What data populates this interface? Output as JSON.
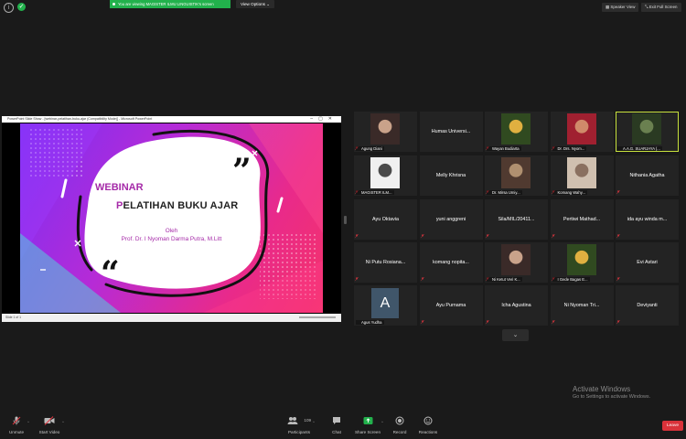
{
  "topbar": {
    "share_banner": "You are viewing MAGISTER ILMU LINGUISTIK's screen",
    "view_options": "View Options",
    "speaker_view": "Speaker View",
    "exit_full_screen": "Exit Full Screen",
    "colors": {
      "banner": "#22b14c"
    }
  },
  "shared_window": {
    "titlebar": "PowerPoint Slide Show - [webinar-pelatihan-buku-ajar (Compatibility Mode)] - Microsoft PowerPoint",
    "status": "Slide 1 of 1",
    "slide": {
      "title": "WEBINAR",
      "subtitle_first": "P",
      "subtitle_rest": "ELATIHAN BUKU AJAR",
      "by": "Oleh",
      "author": "Prof. Dr. I Nyoman Darma Putra, M.Litt"
    }
  },
  "gallery": {
    "tiles": [
      {
        "label": "Agung Diani",
        "video": true,
        "muted": true
      },
      {
        "name": "Humas Universi...",
        "video": false,
        "muted": false
      },
      {
        "label": "Wayan Budiarta",
        "video": true,
        "muted": true
      },
      {
        "label": "Dr. Drs. Nyom...",
        "video": true,
        "muted": true
      },
      {
        "label": "A.A.G. SUARJAYA (...",
        "video": true,
        "muted": false,
        "active": true
      },
      {
        "label": "MAGISTER ILM...",
        "video": true,
        "muted": true
      },
      {
        "name": "Melly Khrisna",
        "video": false,
        "muted": false
      },
      {
        "label": "Dr. Mirsa Umiy...",
        "video": true,
        "muted": true
      },
      {
        "label": "Komang Wahy...",
        "video": true,
        "muted": true
      },
      {
        "name": "Nithania Agatha",
        "video": false,
        "muted": true
      },
      {
        "name": "Ayu Oktavia",
        "video": false,
        "muted": true
      },
      {
        "name": "yuni anggreni",
        "video": false,
        "muted": true
      },
      {
        "name": "Sila/MIL/20411...",
        "video": false,
        "muted": true
      },
      {
        "name": "Pertiwi  Mathad...",
        "video": false,
        "muted": true
      },
      {
        "name": "ida ayu winda m...",
        "video": false,
        "muted": true
      },
      {
        "name": "Ni Putu Rosiana...",
        "video": false,
        "muted": true
      },
      {
        "name": "komang  nopita...",
        "video": false,
        "muted": true
      },
      {
        "label": "Ni Ketut Veri K...",
        "video": true,
        "muted": true
      },
      {
        "label": "I Gede Bagas E...",
        "video": true,
        "muted": true
      },
      {
        "name": "Evi Astari",
        "video": false,
        "muted": true
      },
      {
        "label": "Agus Yudha",
        "video": false,
        "avatar": "A",
        "muted": false
      },
      {
        "name": "Ayu Purnama",
        "video": false,
        "muted": true
      },
      {
        "name": "Icha Agustina",
        "video": false,
        "muted": true
      },
      {
        "name": "Ni Nyoman Tri...",
        "video": false,
        "muted": true
      },
      {
        "name": "Deviyanti",
        "video": false,
        "muted": true
      }
    ],
    "colors": {
      "active_border": "#c8e23d",
      "muted_icon": "#e0363f"
    }
  },
  "watermark": {
    "line1": "Activate Windows",
    "line2": "Go to Settings to activate Windows."
  },
  "toolbar": {
    "unmute": "Unmute",
    "start_video": "Start Video",
    "participants": "Participants",
    "participant_count": "109",
    "chat": "Chat",
    "share_screen": "Share Screen",
    "record": "Record",
    "reactions": "Reactions",
    "leave": "Leave",
    "colors": {
      "leave": "#d9323a",
      "share": "#22b14c"
    }
  }
}
